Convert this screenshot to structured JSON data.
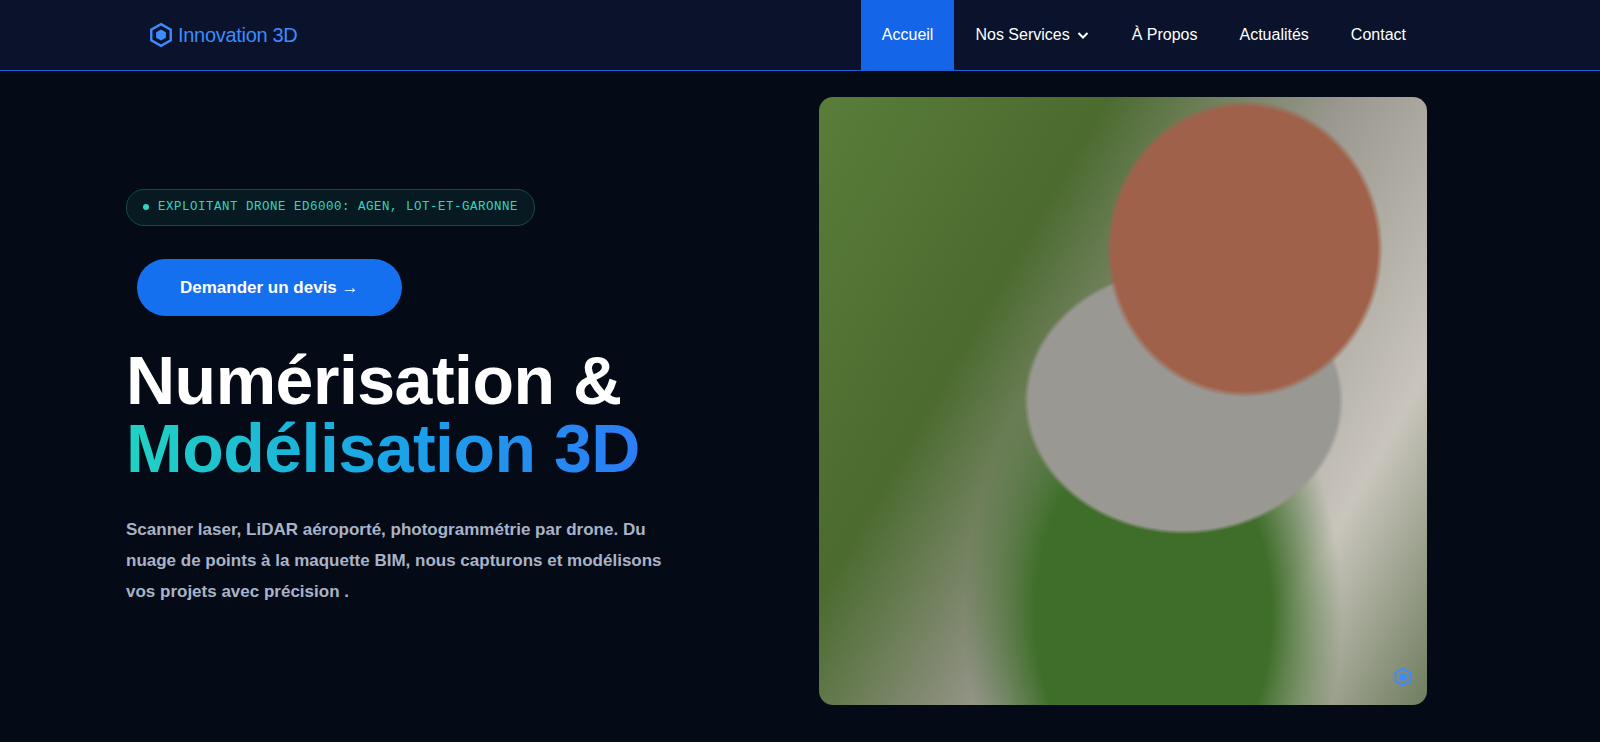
{
  "nav": {
    "logo": "Innovation 3D",
    "items": [
      {
        "label": "Accueil",
        "selected": true,
        "kind": "link"
      },
      {
        "label": "Nos Services",
        "selected": false,
        "kind": "dropdown"
      },
      {
        "label": "À Propos",
        "selected": false,
        "kind": "link"
      },
      {
        "label": "Actualités",
        "selected": false,
        "kind": "link"
      },
      {
        "label": "Contact",
        "selected": false,
        "kind": "link"
      }
    ]
  },
  "hero": {
    "badge": "EXPLOITANT DRONE ED6000: AGEN, LOT-ET-GARONNE",
    "cta": "Demander un devis →",
    "title_line1": "Numérisation &",
    "title_line2": "Modélisation 3D",
    "description": "Scanner laser, LiDAR aéroporté, photogrammétrie par drone. Du nuage de points à la maquette BIM, nous capturons et modélisons vos projets avec précision ."
  }
}
